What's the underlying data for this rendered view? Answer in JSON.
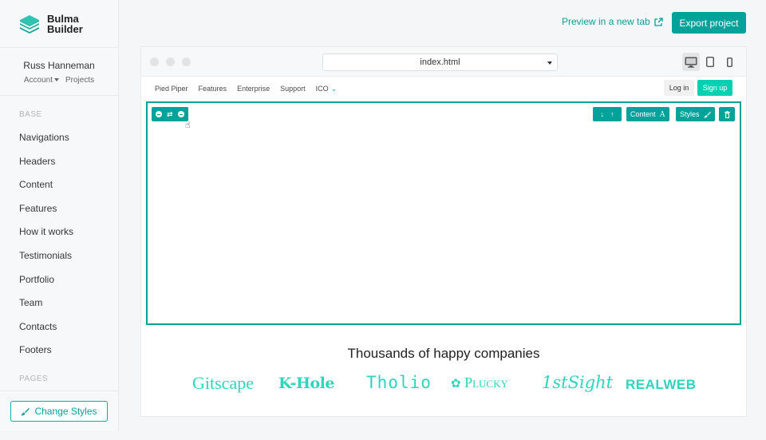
{
  "brand": {
    "line1": "Bulma",
    "line2": "Builder",
    "logo_icon": "layers-icon"
  },
  "user": {
    "name": "Russ Hanneman",
    "account_label": "Account",
    "projects_label": "Projects"
  },
  "sidebar": {
    "sections": [
      {
        "label": "BASE",
        "items": [
          "Navigations",
          "Headers",
          "Content",
          "Features",
          "How it works",
          "Testimonials",
          "Portfolio",
          "Team",
          "Contacts",
          "Footers"
        ]
      },
      {
        "label": "PAGES",
        "items": []
      }
    ],
    "change_styles_label": "Change Styles",
    "change_styles_icon": "paintbrush-icon"
  },
  "topbar": {
    "preview_label": "Preview in a new tab",
    "preview_icon": "external-link-icon",
    "export_label": "Export project"
  },
  "browser": {
    "page_select_value": "index.html",
    "devices": [
      {
        "name": "desktop",
        "icon": "desktop-icon",
        "active": true
      },
      {
        "name": "tablet",
        "icon": "tablet-icon",
        "active": false
      },
      {
        "name": "mobile",
        "icon": "mobile-icon",
        "active": false
      }
    ]
  },
  "site_nav": {
    "links": [
      "Pied Piper",
      "Features",
      "Enterprise",
      "Support",
      "ICO"
    ],
    "login_label": "Log in",
    "signup_label": "Sign up"
  },
  "block_toolbar": {
    "left_icons": [
      "add-above-icon",
      "shuffle-icon",
      "add-below-icon"
    ],
    "move_icons": [
      "arrow-down-icon",
      "arrow-up-icon"
    ],
    "content_label": "Content",
    "styles_label": "Styles",
    "delete_icon": "trash-icon"
  },
  "companies": {
    "title": "Thousands of happy companies",
    "logos": [
      "Gitscape",
      "K-Hole",
      "Tholio",
      "Plucky",
      "1stSight",
      "REALWEB"
    ]
  },
  "colors": {
    "accent": "#00a29a",
    "primary": "#00d1b2",
    "logo_teal": "#2fd4bd"
  }
}
